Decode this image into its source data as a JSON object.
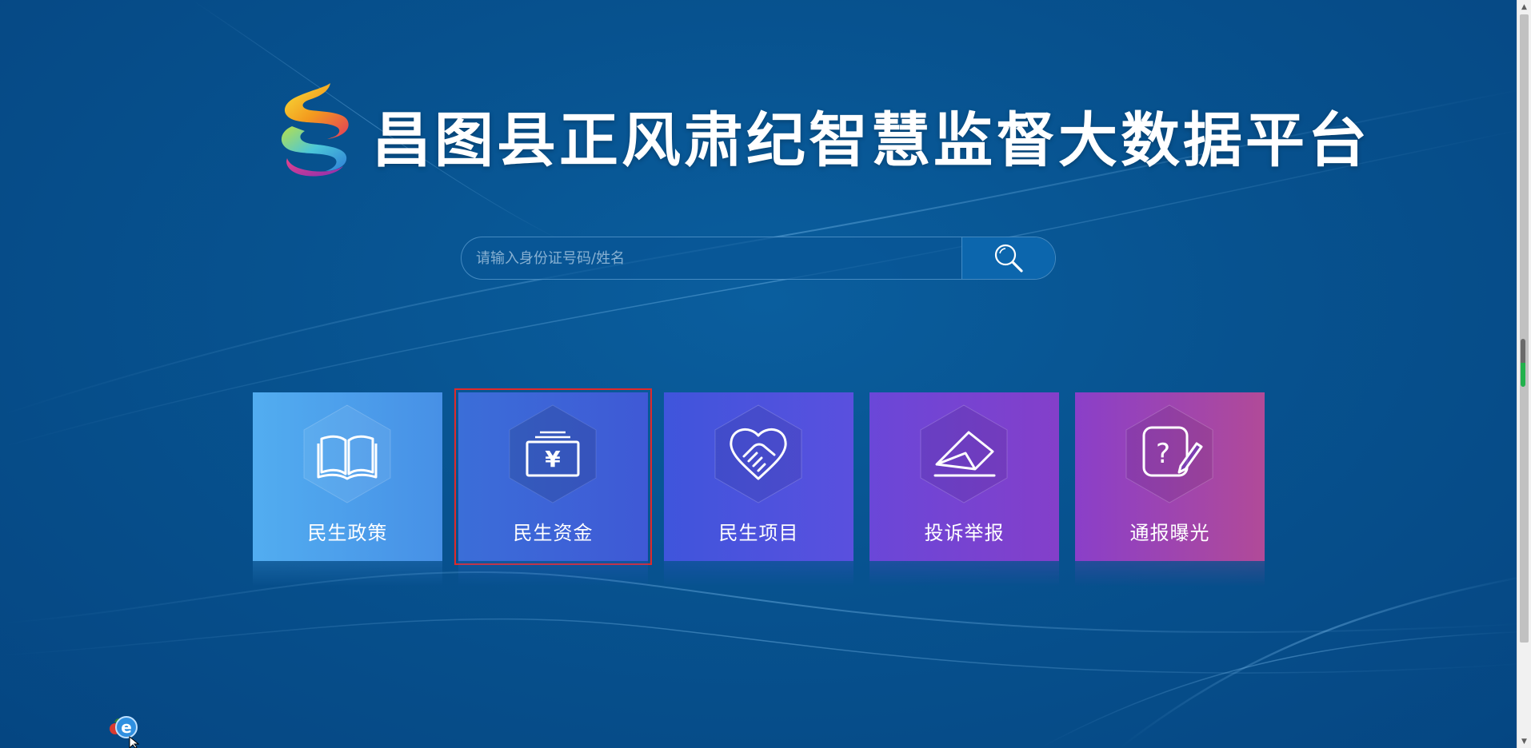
{
  "header": {
    "title": "昌图县正风肃纪智慧监督大数据平台",
    "logo_icon": "swirl-s-logo-icon"
  },
  "search": {
    "placeholder": "请输入身份证号码/姓名",
    "value": "",
    "button_icon": "search-icon"
  },
  "tiles": [
    {
      "label": "民生政策",
      "icon": "open-book-icon",
      "selected": false
    },
    {
      "label": "民生资金",
      "icon": "yuan-money-icon",
      "selected": true
    },
    {
      "label": "民生项目",
      "icon": "handshake-icon",
      "selected": false
    },
    {
      "label": "投诉举报",
      "icon": "envelope-letter-icon",
      "selected": false
    },
    {
      "label": "通报曝光",
      "icon": "question-pencil-icon",
      "selected": false
    }
  ],
  "colors": {
    "background": "#07528f",
    "selection_outline": "#e02a2a",
    "tile_gradients": [
      [
        "#52adf0",
        "#4790e6"
      ],
      [
        "#3b6ed8",
        "#3f59d6"
      ],
      [
        "#3f55dc",
        "#5a50de"
      ],
      [
        "#6a47d8",
        "#843fca"
      ],
      [
        "#8a3fc9",
        "#b14a98"
      ]
    ]
  },
  "tray": {
    "icon": "browser-e-icon"
  }
}
